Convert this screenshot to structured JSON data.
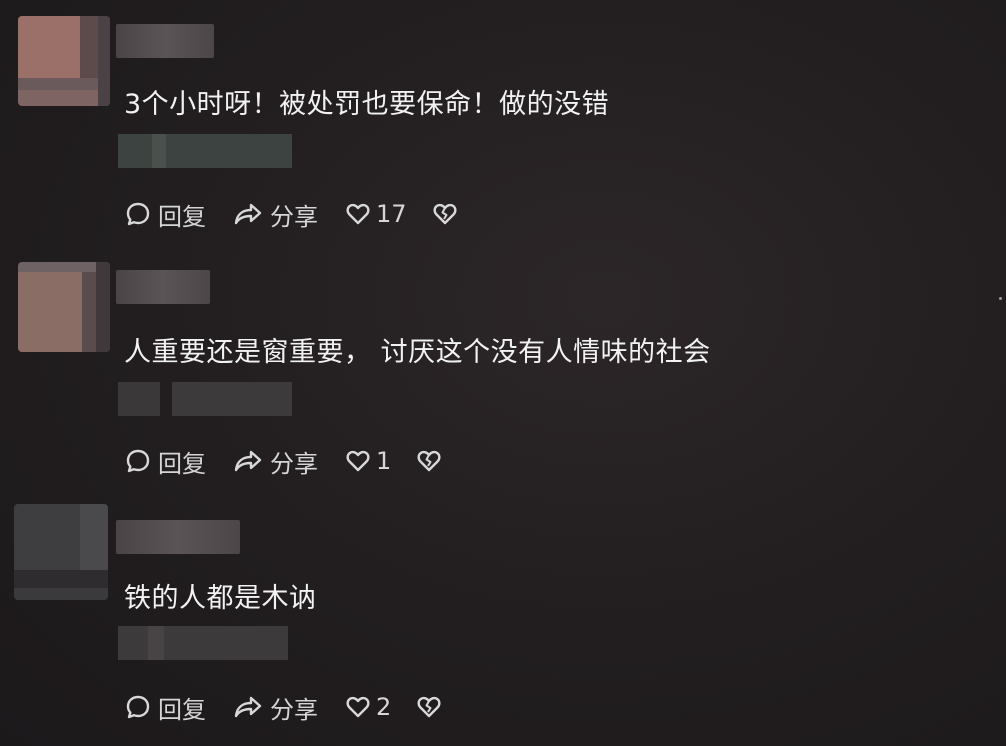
{
  "comments": [
    {
      "text": "3个小时呀！被处罚也要保命！做的没错",
      "reply_label": "回复",
      "share_label": "分享",
      "like_count": "17"
    },
    {
      "text": "人重要还是窗重要， 讨厌这个没有人情味的社会",
      "reply_label": "回复",
      "share_label": "分享",
      "like_count": "1"
    },
    {
      "text": "铁的人都是木讷",
      "reply_label": "回复",
      "share_label": "分享",
      "like_count": "2"
    }
  ],
  "icons": {
    "reply": "chat-bubble-icon",
    "share": "share-arrow-icon",
    "like": "heart-icon",
    "dislike": "broken-heart-icon"
  }
}
